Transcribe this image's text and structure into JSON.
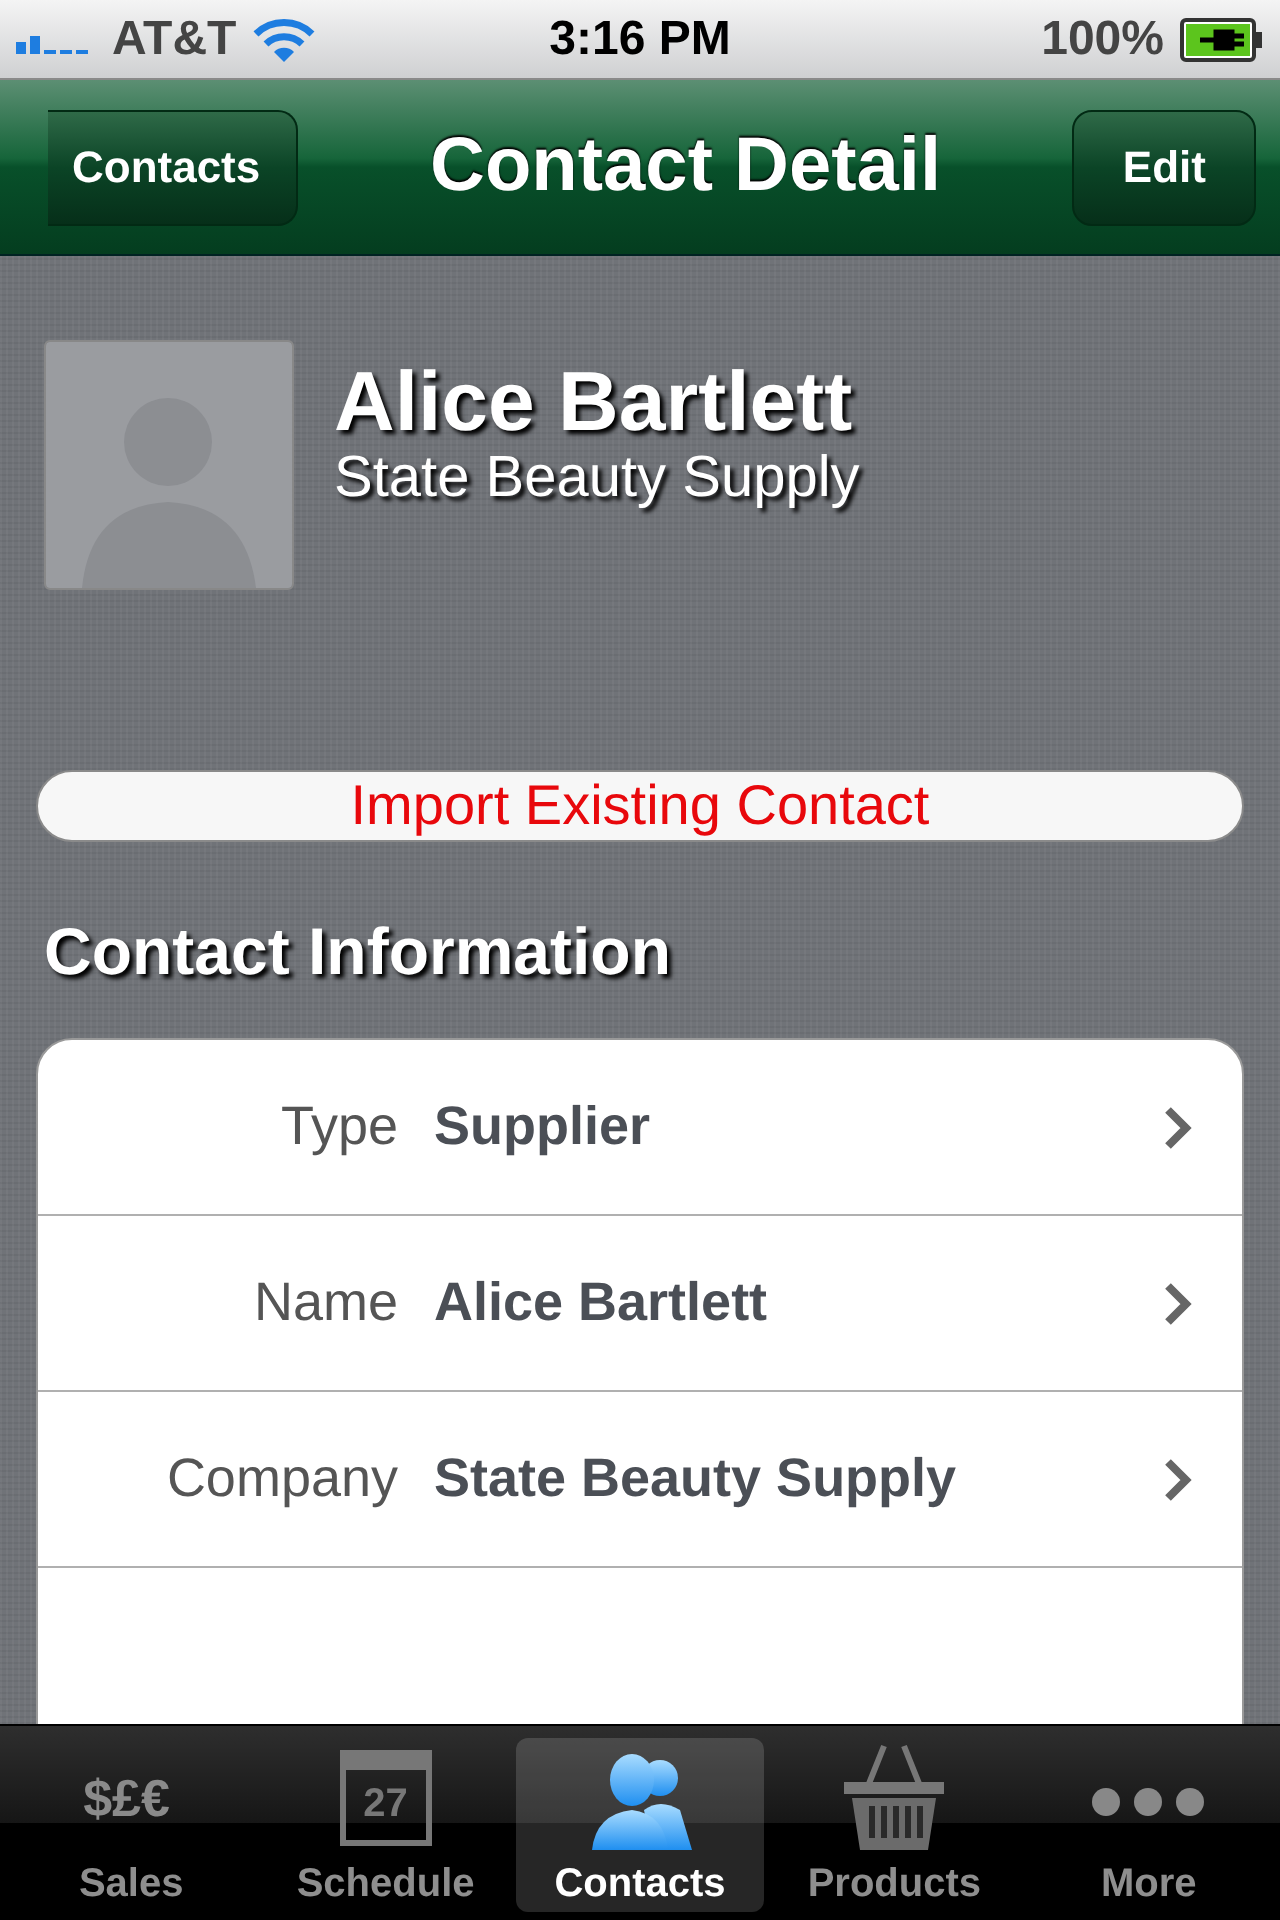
{
  "status_bar": {
    "carrier": "AT&T",
    "time": "3:16 PM",
    "battery": "100%"
  },
  "nav": {
    "back": "Contacts",
    "title": "Contact Detail",
    "action": "Edit"
  },
  "profile": {
    "name": "Alice Bartlett",
    "company": "State Beauty Supply"
  },
  "import_button": "Import Existing Contact",
  "section_title": "Contact Information",
  "fields": [
    {
      "label": "Type",
      "value": "Supplier"
    },
    {
      "label": "Name",
      "value": "Alice Bartlett"
    },
    {
      "label": "Company",
      "value": "State Beauty Supply"
    }
  ],
  "tab_bar": [
    {
      "kind": "currency",
      "glyph": "$£€",
      "label": "Sales",
      "selected": false
    },
    {
      "kind": "calendar",
      "glyph": "27",
      "label": "Schedule",
      "selected": false
    },
    {
      "kind": "people",
      "label": "Contacts",
      "selected": true
    },
    {
      "kind": "basket",
      "label": "Products",
      "selected": false
    },
    {
      "kind": "more",
      "label": "More",
      "selected": false
    }
  ]
}
